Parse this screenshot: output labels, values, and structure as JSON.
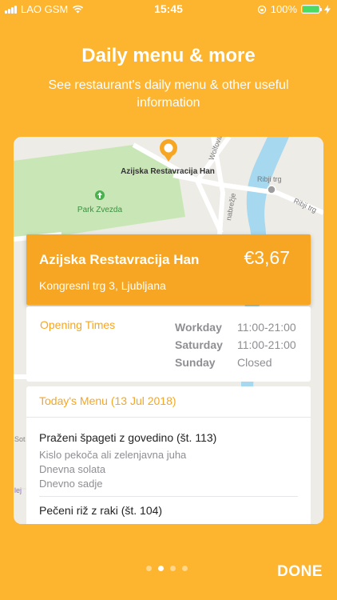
{
  "status": {
    "carrier": "LAO GSM",
    "time": "15:45",
    "battery": "100%"
  },
  "onboarding": {
    "title": "Daily menu & more",
    "subtitle": "See restaurant's daily menu & other useful information"
  },
  "map": {
    "pin_label": "Azijska Restavracija Han",
    "park_label": "Park Zvezda",
    "street_1": "Ribji trg",
    "street_2": "Ribji trg",
    "street_3": "Wolfova",
    "street_4": "nabrežje",
    "edge_1": "Sot",
    "edge_2": "lej"
  },
  "restaurant": {
    "name": "Azijska Restavracija Han",
    "price": "€3,67",
    "address": "Kongresni trg 3, Ljubljana"
  },
  "hours": {
    "title": "Opening Times",
    "rows": [
      {
        "day": "Workday",
        "time": "11:00-21:00"
      },
      {
        "day": "Saturday",
        "time": "11:00-21:00"
      },
      {
        "day": "Sunday",
        "time": "Closed"
      }
    ]
  },
  "menu": {
    "title": "Today's Menu (13 Jul 2018)",
    "item1": "Praženi špageti z govedino (št. 113)",
    "item1_details": [
      "Kislo pekoča ali zelenjavna juha",
      "Dnevna solata",
      "Dnevno sadje"
    ],
    "item2": "Pečeni riž z raki  (št. 104)"
  },
  "footer": {
    "done_label": "DONE",
    "pages": 4,
    "current_page": 2
  },
  "colors": {
    "background": "#FDB42F",
    "accent": "#F6A623",
    "park": "#C8E6B4",
    "water": "#A7D8F0"
  }
}
